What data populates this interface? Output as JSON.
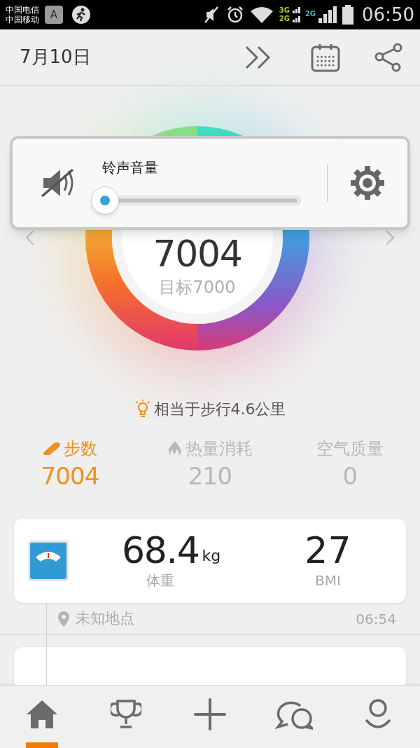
{
  "status_bar": {
    "carriers": [
      "中国电信",
      "中国移动"
    ],
    "keyboard_badge": "A",
    "network_labels": [
      "3G",
      "2G",
      "2G"
    ],
    "time": "06:50"
  },
  "header": {
    "date": "7月10日"
  },
  "ring": {
    "steps": "7004",
    "goal": "目标7000"
  },
  "volume_popup": {
    "label": "铃声音量"
  },
  "tip": "相当于步行4.6公里",
  "stats": [
    {
      "kind": "steps",
      "label": "步数",
      "value": "7004",
      "selected": true
    },
    {
      "kind": "calories",
      "label": "热量消耗",
      "value": "210",
      "selected": false
    },
    {
      "kind": "air",
      "label": "空气质量",
      "value": "0",
      "selected": false
    }
  ],
  "weight_card": {
    "weight": "68.4",
    "unit": "kg",
    "weight_label": "体重",
    "bmi": "27",
    "bmi_label": "BMI"
  },
  "timeline": {
    "location": "未知地点",
    "time": "06:54"
  },
  "nav": [
    {
      "kind": "home",
      "selected": true
    },
    {
      "kind": "trophy",
      "selected": false
    },
    {
      "kind": "add",
      "selected": false
    },
    {
      "kind": "chat",
      "selected": false
    },
    {
      "kind": "profile",
      "selected": false
    }
  ]
}
